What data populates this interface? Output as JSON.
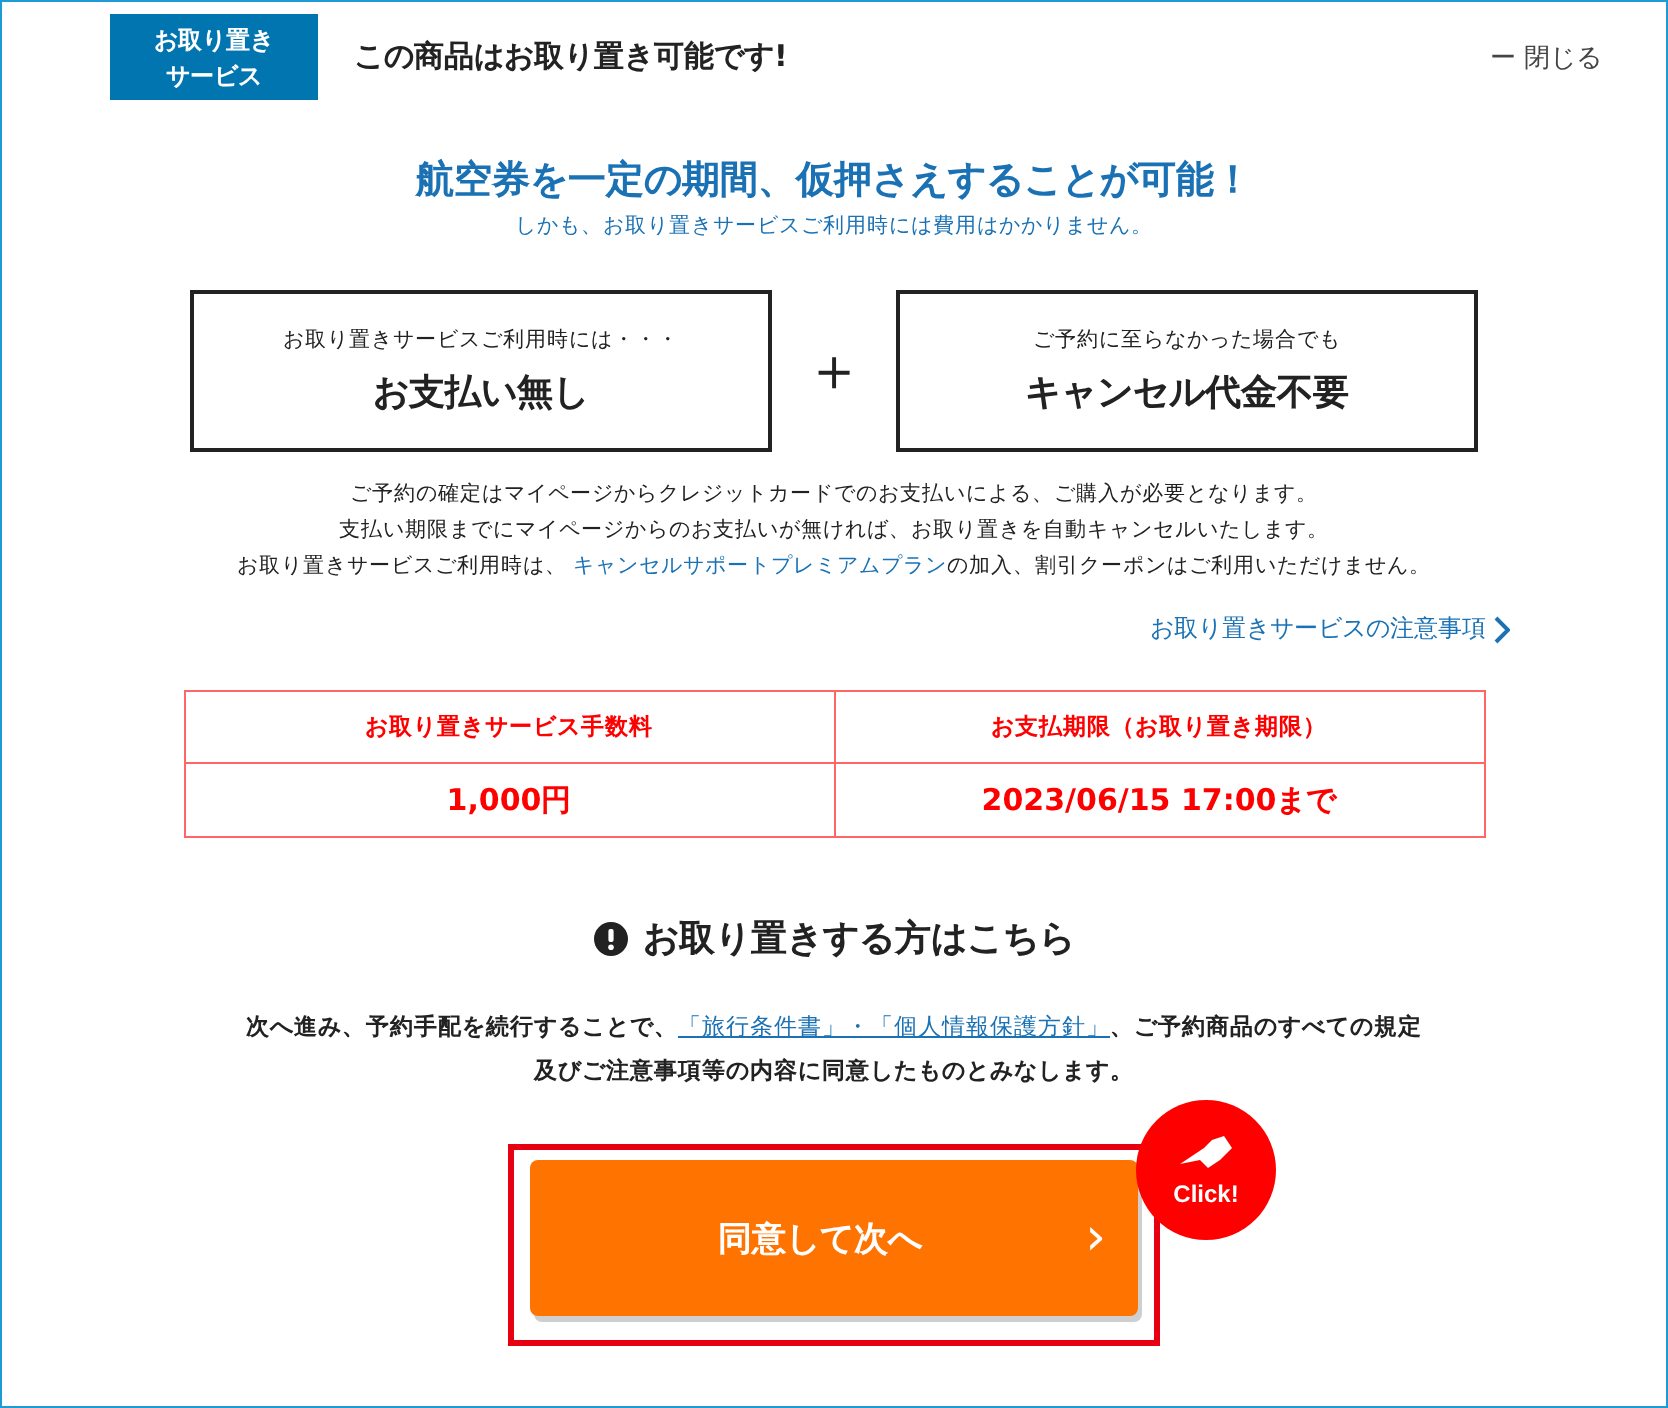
{
  "header": {
    "badge": [
      "お取り置き",
      "サービス"
    ],
    "title": "この商品はお取り置き可能です!",
    "close": {
      "icon": "ー",
      "label": "閉じる"
    }
  },
  "headline": "航空券を一定の期間、仮押さえすることが可能！",
  "subline": "しかも、お取り置きサービスご利用時には費用はかかりません。",
  "benefits": [
    {
      "caption": "お取り置きサービスご利用時には・・・",
      "main": "お支払い無し"
    },
    {
      "caption": "ご予約に至らなかった場合でも",
      "main": "キャンセル代金不要"
    }
  ],
  "plus": "＋",
  "notes": [
    {
      "parts": [
        {
          "kind": "text",
          "text": "ご予約の確定はマイページからクレジットカードでのお支払いによる、ご購入が必要となります。"
        }
      ]
    },
    {
      "parts": [
        {
          "kind": "text",
          "text": "支払い期限までにマイページからのお支払いが無ければ、お取り置きを自動キャンセルいたします。"
        }
      ]
    },
    {
      "parts": [
        {
          "kind": "text",
          "text": "お取り置きサービスご利用時は、 "
        },
        {
          "kind": "link",
          "text": "キャンセルサポートプレミアムプラン"
        },
        {
          "kind": "text",
          "text": "の加入、割引クーポンはご利用いただけません。"
        }
      ]
    }
  ],
  "caution_link": "お取り置きサービスの注意事項",
  "table": {
    "columns": [
      "お取り置きサービス手数料",
      "お支払期限（お取り置き期限）"
    ],
    "rows": [
      [
        "1,000円",
        "2023/06/15 17:00まで"
      ]
    ]
  },
  "section_title": "お取り置きする方はこちら",
  "agreement": {
    "before": "次へ進み、予約手配を続行することで、",
    "link": "「旅行条件書」・「個人情報保護方針」",
    "after": "、ご予約商品のすべての規定",
    "line2": "及びご注意事項等の内容に同意したものとみなします。"
  },
  "button": {
    "label": "同意して次へ",
    "arrow": "›"
  },
  "click_badge": "Click!"
}
